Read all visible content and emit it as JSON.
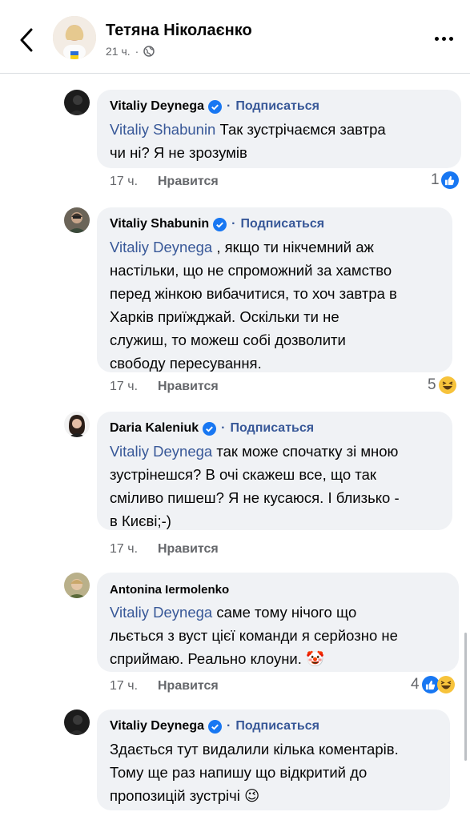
{
  "header": {
    "author": "Тетяна Ніколаєнко",
    "time": "21 ч.",
    "dot": "·"
  },
  "comments": [
    {
      "name": "Vitaliy Deynega",
      "separator": "·",
      "subscribe": "Подписаться",
      "mention": "Vitaliy Shabunin",
      "text_lines": [
        "Так зустрічаємся завтра",
        "чи ні? Я не зрозумів"
      ],
      "time": "17 ч.",
      "like": "Нравится",
      "reaction_count": "1",
      "reactions": [
        "like-icon"
      ]
    },
    {
      "name": "Vitaliy Shabunin",
      "separator": "·",
      "subscribe": "Подписаться",
      "mention": "Vitaliy Deynega",
      "text_lines": [
        ", якщо ти нікчемний аж",
        "настільки, що не спроможний за хамство",
        "перед жінкою вибачитися, то хоч завтра в",
        "Харків приїжджай. Оскільки ти не",
        "служиш, то можеш собі дозволити",
        "свободу пересування."
      ],
      "time": "17 ч.",
      "like": "Нравится",
      "reaction_count": "5",
      "reactions": [
        "haha-icon"
      ]
    },
    {
      "name": "Daria Kaleniuk",
      "separator": "·",
      "subscribe": "Подписаться",
      "mention": "Vitaliy Deynega",
      "text_lines": [
        "так може спочатку зі мною",
        "зустрінешся? В очі скажеш все, що так",
        "сміливо пишеш? Я не кусаюся. І близько -",
        "в Києві;-)"
      ],
      "time": "17 ч.",
      "like": "Нравится"
    },
    {
      "name": "Antonina Iermolenko",
      "mention": "Vitaliy Deynega",
      "text_lines": [
        "саме тому нічого що",
        "льється  з вуст цієї команди я серйозно не",
        "сприймаю. Реально клоуни. 🤡"
      ],
      "time": "17 ч.",
      "like": "Нравится",
      "reaction_count": "4",
      "reactions": [
        "like-icon",
        "haha-icon"
      ]
    },
    {
      "name": "Vitaliy Deynega",
      "separator": "·",
      "subscribe": "Подписаться",
      "text_lines": [
        "Здається тут видалили кілька коментарів.",
        "Тому ще раз напишу що відкритий до",
        "пропозицій зустрічі  😉"
      ]
    }
  ],
  "colors": {
    "link": "#385898",
    "bubble": "#f0f2f5",
    "secondary_text": "#65676b",
    "verified": "#1877f2",
    "like_blue": "#1877f2",
    "haha_yellow": "#f7c33b"
  }
}
